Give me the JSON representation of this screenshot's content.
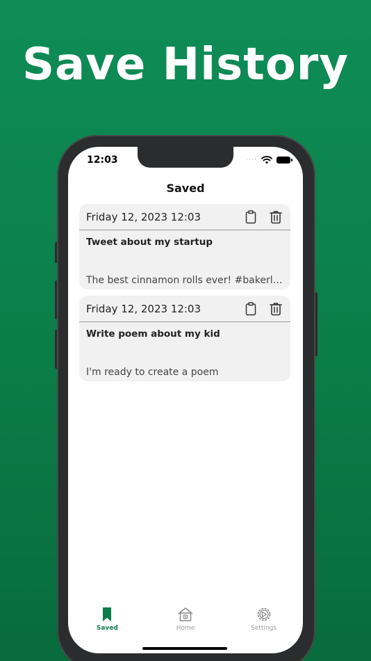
{
  "headline": "Save History",
  "status_bar": {
    "time": "12:03"
  },
  "nav": {
    "title": "Saved"
  },
  "cards": [
    {
      "date": "Friday 12, 2023 12:03",
      "title": "Tweet about my startup",
      "body": "The best cinnamon rolls ever! #bakerlife #..."
    },
    {
      "date": "Friday 12, 2023 12:03",
      "title": "Write poem about my kid",
      "body": "I'm ready to create a poem"
    }
  ],
  "tabbar": {
    "items": [
      {
        "label": "Saved",
        "icon": "bookmark-icon",
        "active": true
      },
      {
        "label": "Home",
        "icon": "home-icon",
        "active": false
      },
      {
        "label": "Settings",
        "icon": "settings-icon",
        "active": false
      }
    ]
  },
  "colors": {
    "background": "#0e8d57",
    "accent": "#0e7b4b",
    "card": "#f1f1f1",
    "inactive": "#9a9a9a"
  }
}
